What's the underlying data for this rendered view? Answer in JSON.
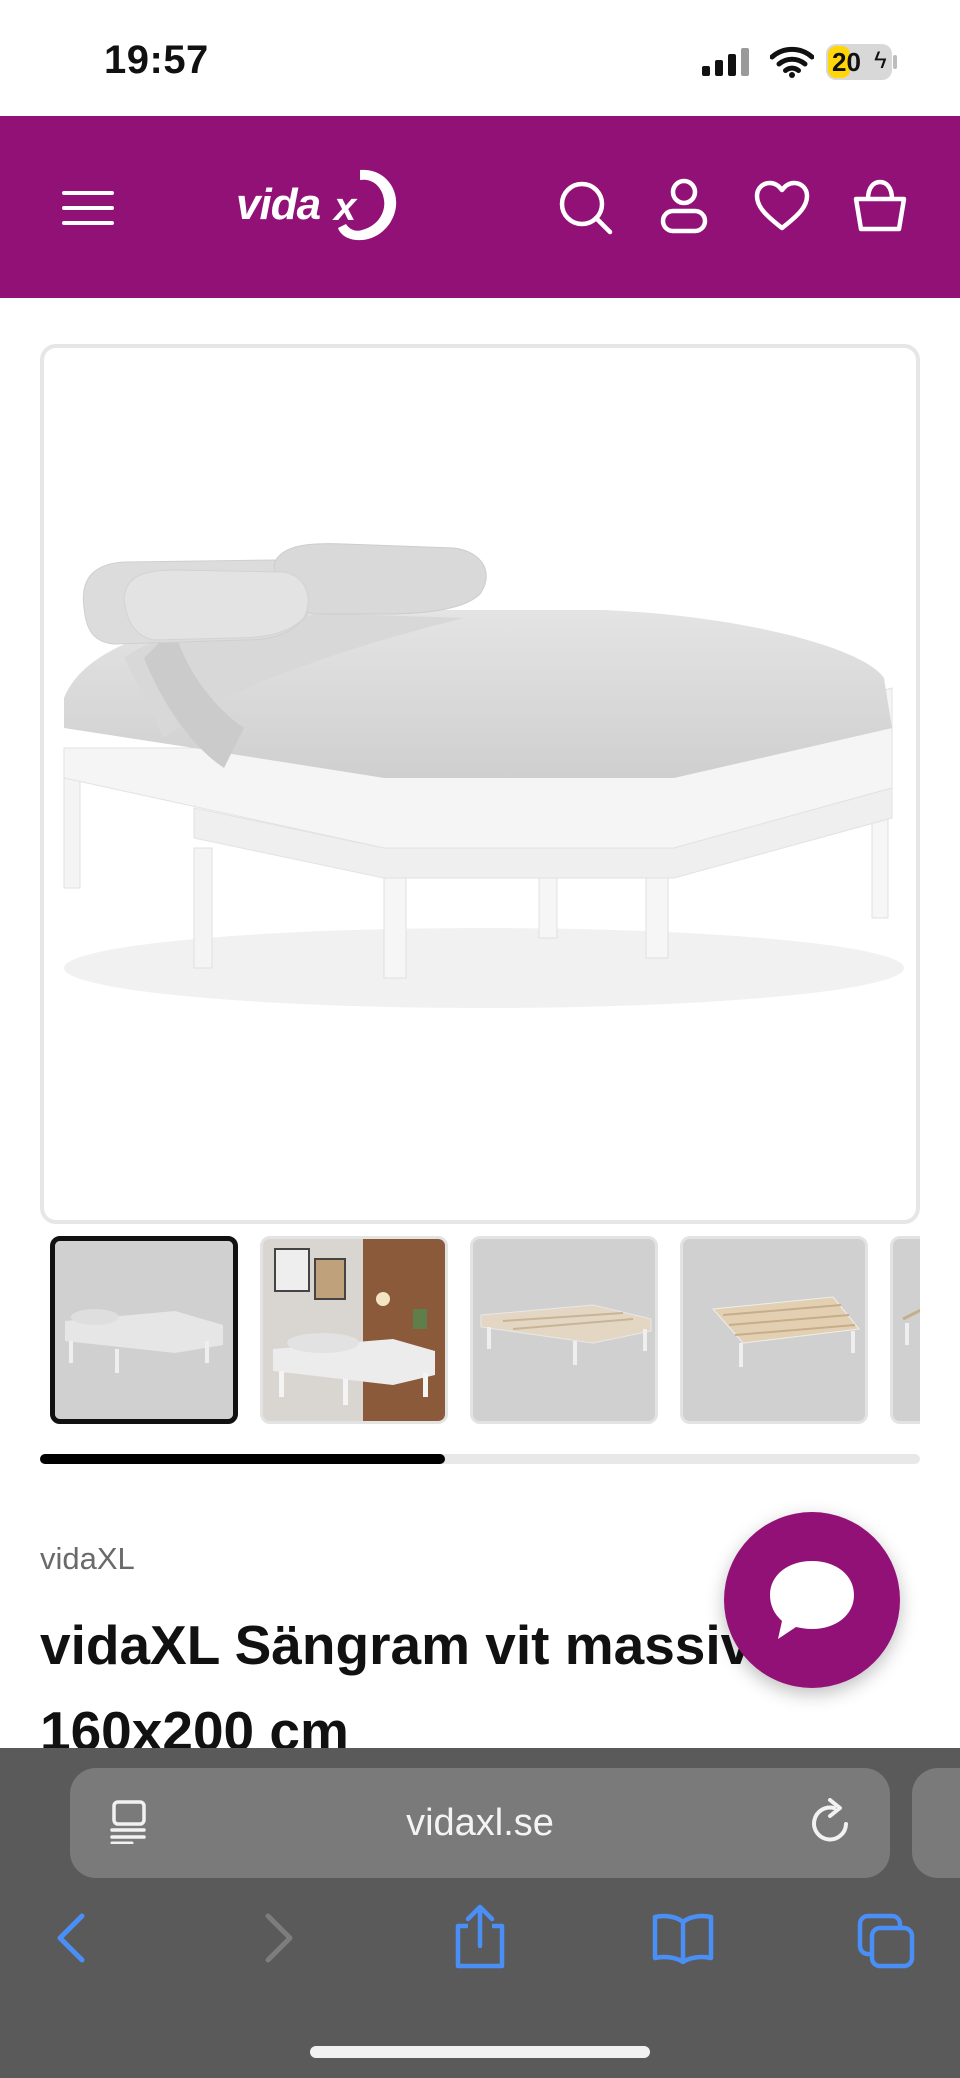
{
  "status": {
    "time": "19:57",
    "battery": "20"
  },
  "header": {
    "logo_text": "vida",
    "logo_badge": "xl",
    "icons": [
      "menu-icon",
      "search-icon",
      "account-icon",
      "heart-icon",
      "basket-icon"
    ]
  },
  "gallery": {
    "thumbnail_count_visible": 5,
    "active_index": 0,
    "scroll_progress": 0.46
  },
  "product": {
    "brand": "vidaXL",
    "title": "vidaXL Sängram vit massiv furu 160x200 cm"
  },
  "browser": {
    "url": "vidaxl.se",
    "icons": [
      "reader-icon",
      "reload-icon",
      "back-icon",
      "forward-icon",
      "share-icon",
      "bookmarks-icon",
      "tabs-icon"
    ]
  },
  "colors": {
    "brand": "#921177",
    "safari_blue": "#4a8ff5"
  }
}
